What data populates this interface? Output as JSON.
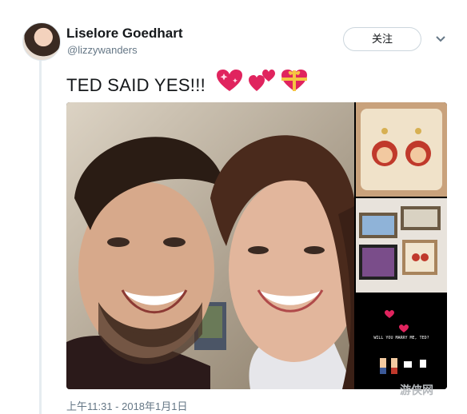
{
  "tweet": {
    "author": {
      "name": "Liselore Goedhart",
      "handle": "@lizzywanders"
    },
    "follow_label": "关注",
    "text": "TED SAID YES!!!",
    "emojis": [
      "sparkling-heart",
      "two-hearts",
      "heart-with-ribbon"
    ],
    "timestamp": "上午11:31 - 2018年1月1日",
    "media": {
      "main_photo": "couple selfie",
      "thumbnails": [
        {
          "subject": "monkey earrings on a pillow"
        },
        {
          "subject": "framed pictures on a bed"
        },
        {
          "subject": "pixel-art proposal screen",
          "caption": "WILL YOU MARRY ME, TED?"
        }
      ]
    }
  },
  "watermark": "游侠网",
  "colors": {
    "secondary_text": "#657786",
    "heart": "#e0245e",
    "border": "#ccd6dd"
  }
}
